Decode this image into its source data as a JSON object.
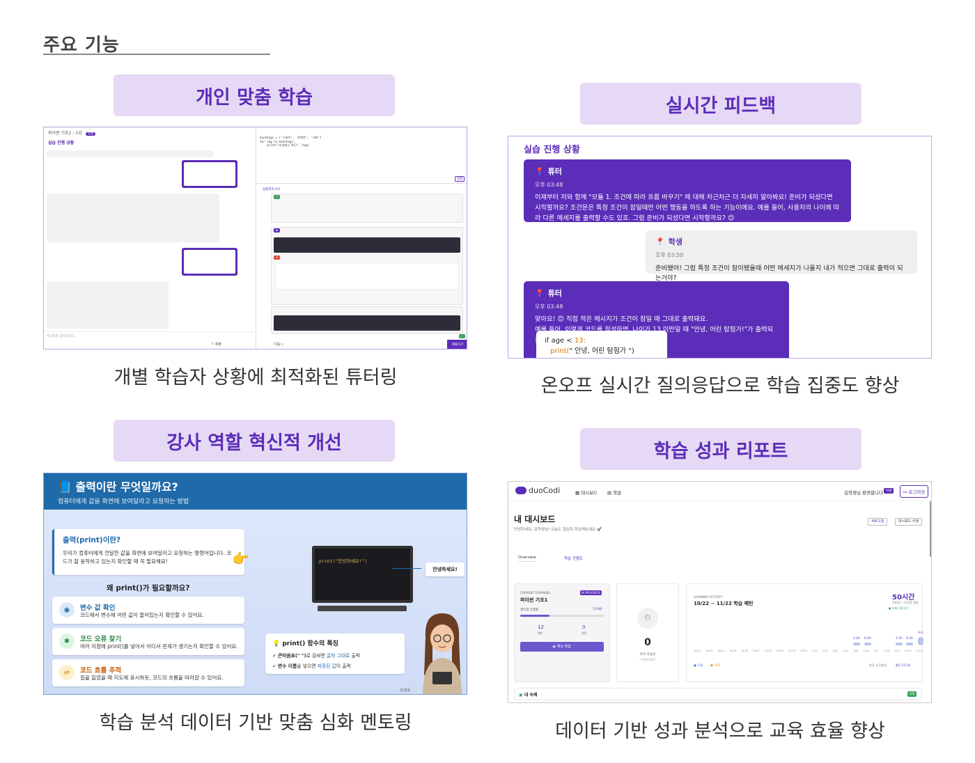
{
  "section_title": "주요 기능",
  "features": [
    {
      "title": "개인 맞춤 학습",
      "caption": "개별 학습자 상황에 최적화된 튜터링"
    },
    {
      "title": "실시간 피드백",
      "caption": "온오프 실시간 질의응답으로 학습 집중도 향상"
    },
    {
      "title": "강사 역할 혁신적 개선",
      "caption": "학습 분석 데이터 기반 맞춤 심화 멘토링"
    },
    {
      "title": "학습 성과 리포트",
      "caption": "데이터 기반 성과 분석으로 교육 효율 향상"
    }
  ],
  "p1": {
    "header": "파이썬 기초2 › 5강",
    "badge": "진행",
    "section": "실습 진행 상황",
    "code_top": "hashtags = ['스위치', '포켓몬', '커피']\nfor tag in hashtags:\n    print(\"인기태그 #{}\", tag)",
    "run_label": "실행",
    "result_title": "실행결과 4/5",
    "input_label": "메시지를 입력하세요...",
    "send_label": "↑ 제출",
    "next_label": "다음 ▷",
    "submit_label": "제출하기"
  },
  "p2": {
    "title": "실습 진행 상황",
    "msg1_who": "튜터",
    "msg1_time": "오후 03:48",
    "msg1_text": "이제부터 저와 함께 \"모듈 1. 조건에 따라 흐름 바꾸기\" 에 대해 차근차근 더 자세히 알아봐요! 준비가 되셨다면 시작할까요? 조건문은 특정 조건이 참일때만 어떤 행동을 하도록 하는 기능이에요. 예를 들어, 사용자의 나이에 따라 다른 메세지를 출력할 수도 있죠. 그럼 준비가 되셨다면 시작할까요? 😊",
    "msg2_who": "학생",
    "msg2_time": "오후 03:50",
    "msg2_text": "준비됐어! 그럼 특정 조건이 참이됐을때 어떤 메세지가 나올지 내가 적으면 그대로 출력이 되는거야?",
    "msg3_who": "튜터",
    "msg3_time": "오후 03:48",
    "msg3_line1": "맞아요! 😊 직접 적은 메시지가 조건이 참일 때 그대로 출력돼요.",
    "msg3_line2": "예를 들어, 이렇게 코드를 작성하면, 나이가 13 미만일 때 \"안녕, 어린 탐험가!\"가 출력되는 거에요.",
    "code_line1_a": "if age < ",
    "code_line1_b": "13:",
    "code_line2_a": "print(",
    "code_line2_b": "\" 안녕, 어린 탐험가 \")"
  },
  "p3": {
    "title": "📘 출력이란 무엇일까요?",
    "subtitle": "컴퓨터에게 값을 화면에 보여달라고 요청하는 방법",
    "def_title": "출력(print)이란?",
    "def_text": "우리가 컴퓨터에게 전달한 값을 화면에 보여달라고 요청하는 명령어입니다. 코드가 잘 동작하고 있는지 확인할 때 꼭 필요해요!",
    "why_title": "왜 print()가 필요할까요?",
    "reasons": [
      {
        "title": "변수 값 확인",
        "text": "코드에서 변수에 어떤 값이 들어있는지 확인할 수 있어요.",
        "icon": "eye-icon"
      },
      {
        "title": "코드 오류 찾기",
        "text": "여러 지점에 print()를 넣어서 어디서 문제가 생기는지 확인할 수 있어요.",
        "icon": "bug-icon"
      },
      {
        "title": "코드 흐름 추적",
        "text": "길을 잃었을 때 지도에 표시하듯, 코드의 흐름을 따라갈 수 있어요.",
        "icon": "route-icon"
      }
    ],
    "screen_code": "print(\"안녕하세요!\")",
    "output_bubble": "안녕하세요!",
    "feature_title": "print() 함수의 특징",
    "feat1_a": "큰따옴표(\" \")",
    "feat1_b": "로 감싸면 ",
    "feat1_c": "글자 그대로",
    "feat1_d": " 출력",
    "feat2_a": "변수 이름",
    "feat2_b": "을 넣으면 ",
    "feat2_c": "저장된 값",
    "feat2_d": "이 출력",
    "page": "초/중등"
  },
  "p4": {
    "logo": "duoCodi",
    "nav1": "대시보드",
    "nav2": "학습",
    "welcome": "김학생님 환영합니다",
    "role": "학생",
    "logout": "로그아웃",
    "title": "내 대시보드",
    "subtitle": "안녕하세요, 김학생님! 오늘도 열심히 학습해보세요 🚀",
    "refresh": "새로고침",
    "edit": "대시보드 수정",
    "tab1": "Overview",
    "tab2": "학습 진행도",
    "cl_label": "CURRENT LEARNING",
    "cl_badge": "IN PROGRESS",
    "course": "파이썬 기초1",
    "progress_label": "챕터별 진행률",
    "progress_value": "17/48",
    "progress_fraction": 0.354,
    "stat1": "12",
    "stat1_label": "예년",
    "stat2": "0",
    "stat2_label": "완료",
    "continue": "▶ 계속 학습",
    "streak": "0",
    "streak_label": "연속 학습일",
    "streak_sub": "시작해보세요!",
    "la_label": "LEARNING ACTIVITY",
    "la_title": "10/22 ~ 11/22 학습 패턴",
    "hours": "50시간",
    "hours_sub": "10/22 ~ 11/22 총합",
    "hours_note": "● 실제 사용시간",
    "bar_labels": [
      "1.2h",
      "0.5h",
      "1.5h",
      "0.3h",
      "9.0"
    ],
    "dates": [
      "10/22",
      "10/23",
      "10/24",
      "10/25",
      "10/26",
      "10/27",
      "10/28",
      "10/29",
      "10/30",
      "10/31",
      "11/1",
      "11/2",
      "11/3",
      "11/4",
      "11/5",
      "11/6",
      "11/7",
      "11/8",
      "11/9",
      "11/10",
      "11/11"
    ],
    "legend1": "● 오늘",
    "legend2": "● 어제",
    "avg": "평균: 4.2분/일",
    "note": "향후 11/7일",
    "homework": "내 숙제",
    "homework_badge": "0개",
    "colors": {
      "accent": "#5b2db8",
      "progress": "#6a5acd",
      "green": "#3aa35a"
    }
  }
}
